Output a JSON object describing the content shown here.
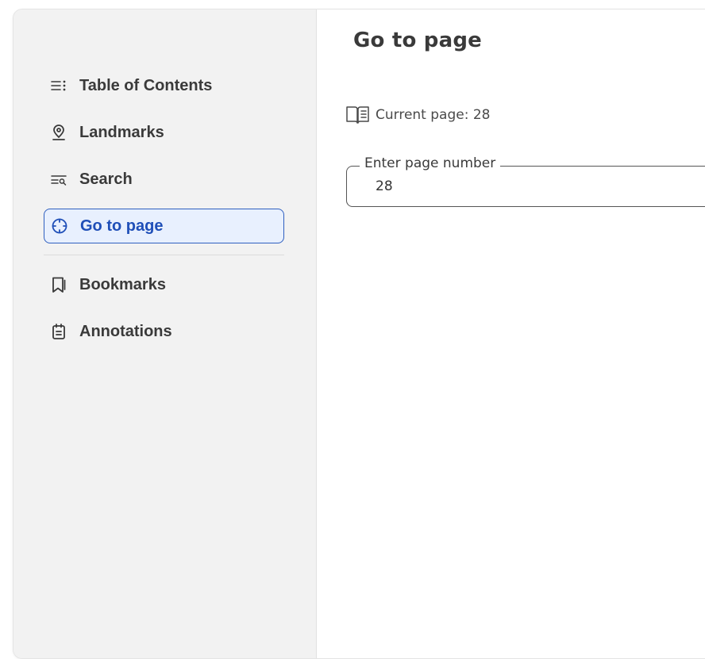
{
  "sidebar": {
    "items": [
      {
        "label": "Table of Contents",
        "icon": "list-icon"
      },
      {
        "label": "Landmarks",
        "icon": "location-pin-icon"
      },
      {
        "label": "Search",
        "icon": "search-list-icon"
      },
      {
        "label": "Go to page",
        "icon": "crosshair-icon",
        "active": true
      },
      {
        "label": "Bookmarks",
        "icon": "bookmark-icon"
      },
      {
        "label": "Annotations",
        "icon": "clipboard-icon"
      }
    ]
  },
  "main": {
    "title": "Go to page",
    "current_page_text": "Current page: 28",
    "page_input": {
      "label": "Enter page number",
      "value": "28"
    }
  },
  "colors": {
    "accent": "#1f4fb8",
    "active_bg": "#e8f0fe",
    "sidebar_bg": "#f2f2f2"
  }
}
